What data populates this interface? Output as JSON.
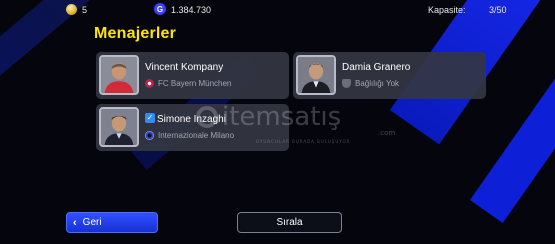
{
  "topbar": {
    "coins": "5",
    "gp_icon": "G",
    "gp": "1.384.730",
    "capacity_label": "Kapasite:",
    "capacity_value": "3/50"
  },
  "page": {
    "title": "Menajerler"
  },
  "managers": [
    {
      "name": "Vincent Kompany",
      "club": "FC Bayern München",
      "club_icon": "bayern-crest-icon",
      "icon_color": "#d11b3b"
    },
    {
      "name": "Damia Granero",
      "club": "Bağlılığı Yok",
      "club_icon": "shield-icon",
      "icon_color": "#8b8e99"
    },
    {
      "name": "Simone Inzaghi",
      "club": "Internazionale Milano",
      "club_icon": "inter-crest-icon",
      "icon_color": "#2a4bd6",
      "selected": true
    }
  ],
  "watermark": {
    "text": "itemsatış",
    "suffix": ".com",
    "tagline": "OYUNCULAR BURADA BULUŞUYOR"
  },
  "buttons": {
    "back_label": "Geri",
    "sort_label": "Sırala"
  },
  "colors": {
    "title": "#ffe500",
    "accent": "#1f3df0",
    "card_bg": "#343642"
  }
}
